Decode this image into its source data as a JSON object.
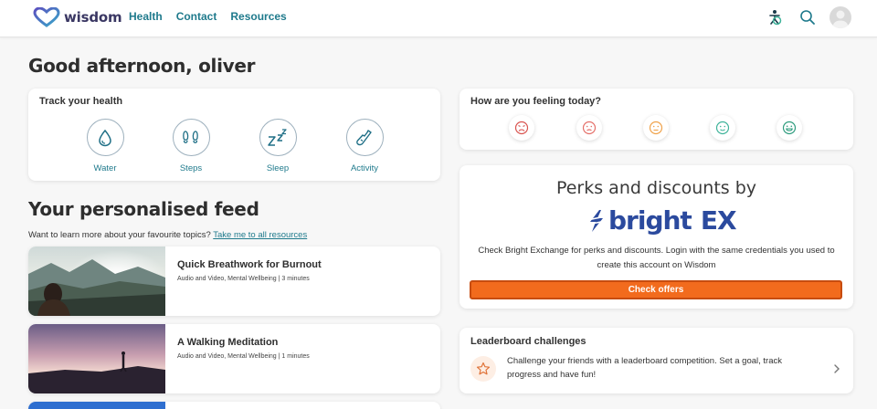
{
  "header": {
    "logo_text": "wisdom",
    "nav": [
      "Health",
      "Contact",
      "Resources"
    ],
    "icons": [
      "accessibility-icon",
      "search-icon",
      "avatar"
    ]
  },
  "greeting": "Good afternoon, oliver",
  "track": {
    "title": "Track your health",
    "items": [
      {
        "label": "Water",
        "icon": "water-drop-icon"
      },
      {
        "label": "Steps",
        "icon": "footsteps-icon"
      },
      {
        "label": "Sleep",
        "icon": "sleep-zzz-icon"
      },
      {
        "label": "Activity",
        "icon": "running-shoe-icon"
      }
    ]
  },
  "feeling": {
    "title": "How are you feeling today?",
    "moods": [
      {
        "name": "very-sad",
        "color": "#d9534f"
      },
      {
        "name": "sad",
        "color": "#e5706a"
      },
      {
        "name": "neutral",
        "color": "#f0a24a"
      },
      {
        "name": "happy",
        "color": "#3fb39a"
      },
      {
        "name": "very-happy",
        "color": "#2e9c7e"
      }
    ]
  },
  "feed": {
    "title": "Your personalised feed",
    "subtitle": "Want to learn more about your favourite topics?",
    "link": "Take me to all resources",
    "items": [
      {
        "title": "Quick Breathwork for Burnout",
        "meta": "Audio and Video, Mental Wellbeing | 3 minutes"
      },
      {
        "title": "A Walking Meditation",
        "meta": "Audio and Video, Mental Wellbeing | 1 minutes"
      }
    ]
  },
  "perks": {
    "title": "Perks and discounts by",
    "brand": "bright",
    "brand_suffix": "EX",
    "description": "Check Bright Exchange for perks and discounts. Login with the same credentials you used to create this account on Wisdom",
    "cta": "Check offers"
  },
  "leaderboard": {
    "title": "Leaderboard challenges",
    "description": "Challenge your friends with a leaderboard competition. Set a goal, track progress and have fun!"
  },
  "colors": {
    "accent": "#1f7a8c",
    "brand_blue": "#2b4a9e",
    "cta_orange": "#f26b1d",
    "logo_purple": "#3a3763"
  }
}
